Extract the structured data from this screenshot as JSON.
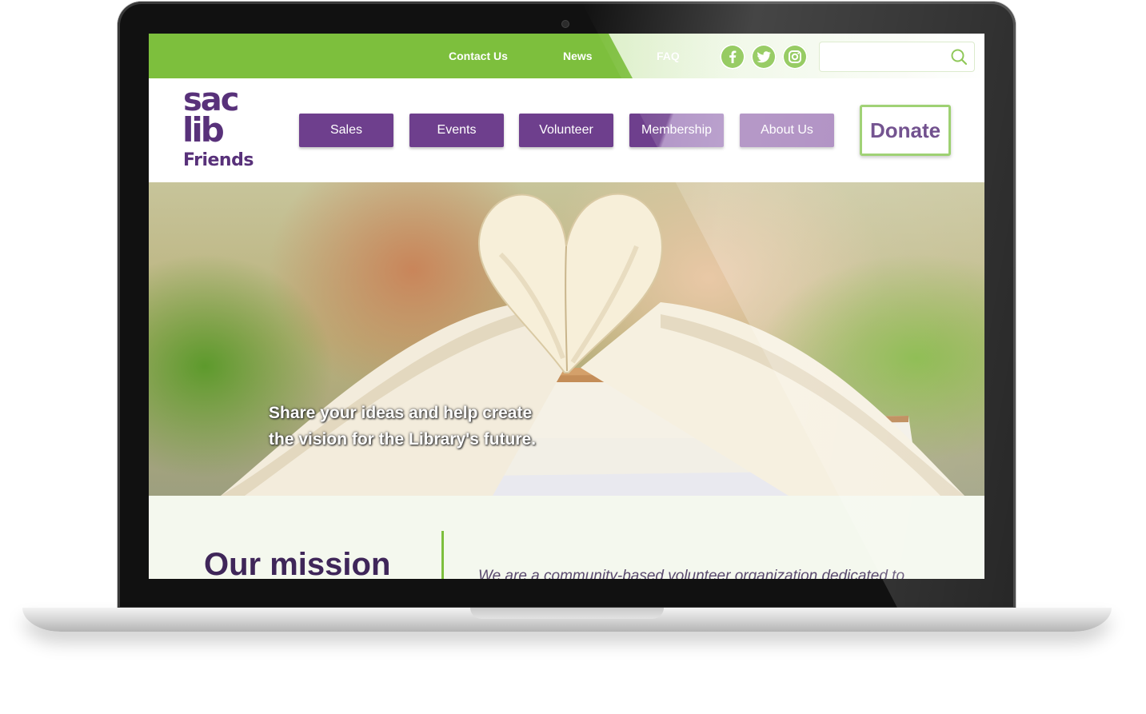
{
  "topbar": {
    "links": [
      "Contact Us",
      "News",
      "FAQ"
    ],
    "social": [
      "facebook-icon",
      "twitter-icon",
      "instagram-icon"
    ],
    "search": {
      "placeholder": "",
      "value": ""
    },
    "colors": {
      "bar": "#7dbf3d"
    }
  },
  "logo": {
    "line1": "sac",
    "line2": "lib",
    "line3": "Friends",
    "color": "#58317a"
  },
  "nav": {
    "items": [
      "Sales",
      "Events",
      "Volunteer",
      "Membership",
      "About Us"
    ],
    "donate": "Donate",
    "colors": {
      "button": "#6e3f8d",
      "donate_border": "#8dc95a"
    }
  },
  "hero": {
    "caption_line1": "Share your ideas and help create",
    "caption_line2": "the vision for the Library's future."
  },
  "mission": {
    "title": "Our mission",
    "text": "We are a community-based volunteer organization dedicated to"
  }
}
